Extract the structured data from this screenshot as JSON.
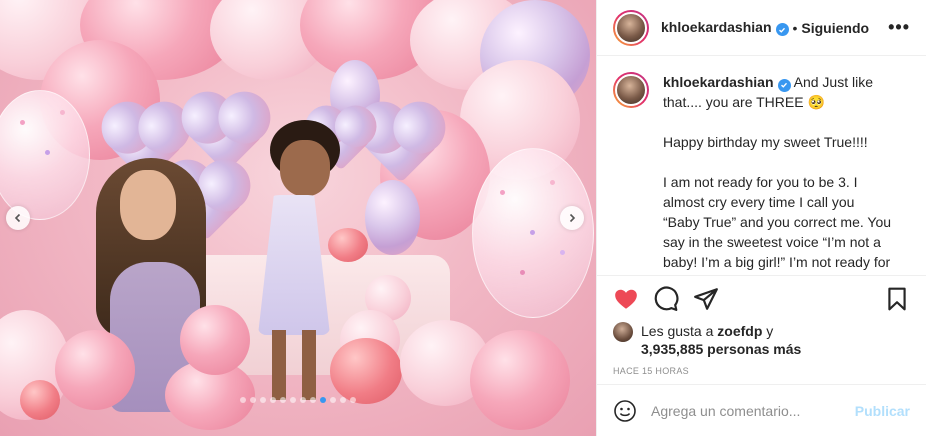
{
  "post": {
    "username": "khloekardashian",
    "follow_status": "Siguiendo",
    "separator": "•",
    "more_label": "•••",
    "caption": {
      "line1": "And Just like that.... you are THREE",
      "emoji": "🥺",
      "p2": "Happy birthday my sweet True!!!!",
      "p3": "I am not ready for you to be 3. I almost cry every time I call you “Baby True” and you correct me. You say in the sweetest voice “I’m not a baby! I’m a big girl!” I’m not ready for you to be"
    },
    "likes": {
      "prefix": "Les gusta a",
      "liker": "zoefdp",
      "joiner": "y",
      "count": "3,935,885 personas más"
    },
    "timestamp": "HACE 15 HORAS",
    "comment": {
      "placeholder": "Agrega un comentario...",
      "publish_label": "Publicar"
    }
  },
  "carousel": {
    "total_slides": 12,
    "active_index": 8
  },
  "colors": {
    "accent": "#3897f0",
    "like_red": "#ed4956",
    "publish_disabled": "#b2dffc"
  },
  "icons": [
    "verified-badge-icon",
    "heart-icon",
    "comment-icon",
    "share-icon",
    "bookmark-icon",
    "emoji-icon",
    "chevron-left-icon",
    "chevron-right-icon"
  ]
}
